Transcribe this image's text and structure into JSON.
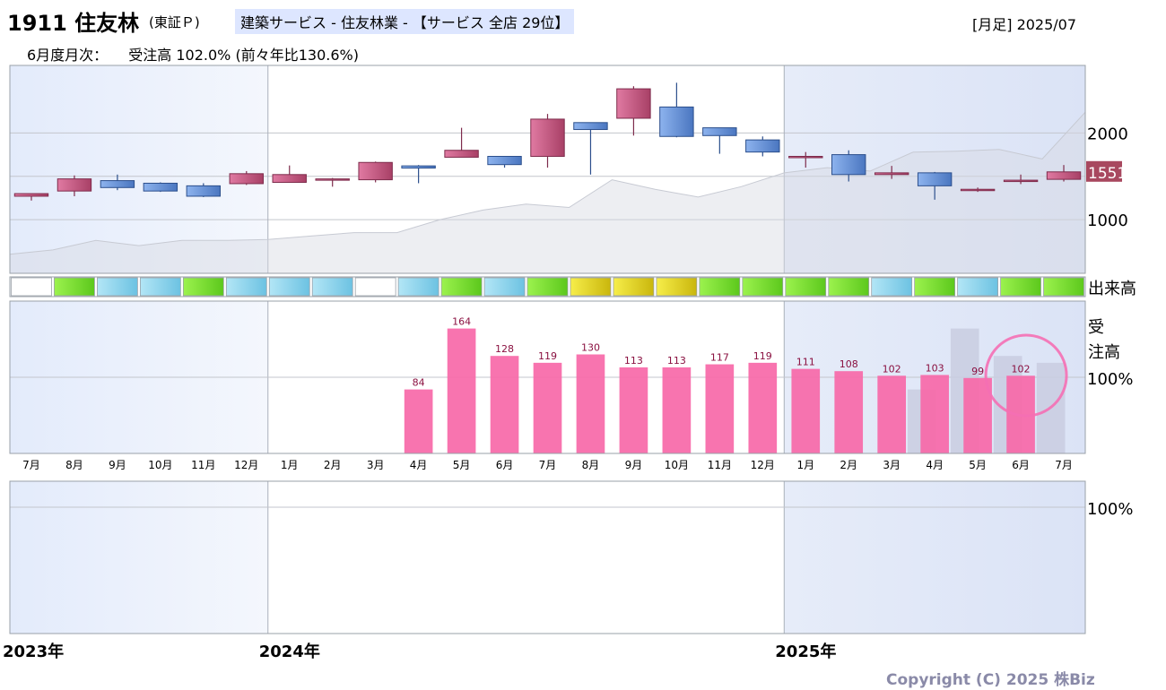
{
  "header": {
    "code_name": "1911 住友林",
    "exchange": "(東証Ｐ)",
    "sector": "建築サービス - 住友林業 - 【サービス 全店 29位】",
    "period": "[月足] 2025/07",
    "monthly_label": "6月度月次：",
    "monthly_value": "受注高 102.0% (前々年比130.6%)"
  },
  "copyright": "Copyright (C) 2025 株Biz",
  "colors": {
    "up": "#c8517a",
    "down": "#5b8bd6",
    "order_bar": "#f768a8",
    "prev_bar": "#c9cce0",
    "highlight_ring": "#f56fb4",
    "shade": "#eaf0fb",
    "volume_light": "#ffffff",
    "volume_green": "#7de632",
    "volume_blue": "#8fd6ee",
    "volume_yellow": "#e8da20"
  },
  "chart_data": [
    {
      "type": "candlestick",
      "title": "",
      "x": [
        "2023/07",
        "2023/08",
        "2023/09",
        "2023/10",
        "2023/11",
        "2023/12",
        "2024/01",
        "2024/02",
        "2024/03",
        "2024/04",
        "2024/05",
        "2024/06",
        "2024/07",
        "2024/08",
        "2024/09",
        "2024/10",
        "2024/11",
        "2024/12",
        "2025/01",
        "2025/02",
        "2025/03",
        "2025/04",
        "2025/05",
        "2025/06",
        "2025/07"
      ],
      "open": [
        1270,
        1330,
        1450,
        1420,
        1390,
        1415,
        1430,
        1460,
        1460,
        1620,
        1720,
        1730,
        1730,
        2120,
        2170,
        2300,
        2060,
        1920,
        1730,
        1750,
        1520,
        1540,
        1350,
        1445,
        1465
      ],
      "close": [
        1300,
        1470,
        1370,
        1330,
        1270,
        1530,
        1520,
        1470,
        1660,
        1595,
        1800,
        1635,
        2160,
        2040,
        2510,
        1960,
        1970,
        1780,
        1730,
        1520,
        1540,
        1390,
        1350,
        1455,
        1551
      ],
      "high": [
        1300,
        1510,
        1520,
        1430,
        1420,
        1560,
        1625,
        1480,
        1670,
        1630,
        2060,
        1730,
        2220,
        2040,
        2540,
        2580,
        2050,
        1960,
        1780,
        1800,
        1620,
        1550,
        1370,
        1520,
        1630
      ],
      "low": [
        1220,
        1270,
        1340,
        1320,
        1260,
        1400,
        1440,
        1380,
        1430,
        1420,
        1780,
        1600,
        1600,
        1520,
        1970,
        1950,
        1760,
        1730,
        1600,
        1440,
        1470,
        1230,
        1320,
        1410,
        1440
      ],
      "overlay_area": {
        "name": "",
        "values": [
          600,
          650,
          760,
          700,
          760,
          760,
          770,
          810,
          850,
          850,
          1000,
          1110,
          1180,
          1140,
          1460,
          1350,
          1260,
          1380,
          1540,
          1600,
          1560,
          1780,
          1790,
          1810,
          1700,
          2240
        ]
      },
      "last_price": 1551,
      "y_ticks": [
        1000,
        2000
      ],
      "ylim": [
        380,
        2780
      ]
    },
    {
      "type": "color_strip",
      "label": "出来高",
      "colors": [
        "light",
        "green",
        "blue",
        "blue",
        "green",
        "blue",
        "blue",
        "blue",
        "light",
        "blue",
        "green",
        "blue",
        "green",
        "yellow",
        "yellow",
        "yellow",
        "green",
        "green",
        "green",
        "green",
        "blue",
        "green",
        "blue",
        "green",
        "green"
      ]
    },
    {
      "type": "bar",
      "label_lines": [
        "受",
        "注高"
      ],
      "y_tick": "100%",
      "categories": [
        "7月",
        "8月",
        "9月",
        "10月",
        "11月",
        "12月",
        "1月",
        "2月",
        "3月",
        "4月",
        "5月",
        "6月",
        "7月",
        "8月",
        "9月",
        "10月",
        "11月",
        "12月",
        "1月",
        "2月",
        "3月",
        "4月",
        "5月",
        "6月",
        "7月"
      ],
      "values": [
        null,
        null,
        null,
        null,
        null,
        null,
        null,
        null,
        null,
        84,
        164,
        128,
        119,
        130,
        113,
        113,
        117,
        119,
        111,
        108,
        102,
        103,
        99,
        102,
        null
      ],
      "prev_values": [
        null,
        null,
        null,
        null,
        null,
        null,
        null,
        null,
        null,
        null,
        null,
        null,
        null,
        null,
        null,
        null,
        null,
        null,
        null,
        null,
        null,
        84,
        164,
        128,
        119
      ],
      "highlight_index": 23,
      "ylim": [
        0,
        200
      ]
    },
    {
      "type": "empty_panel",
      "y_tick": "100%"
    }
  ],
  "years": [
    "2023年",
    "2024年",
    "2025年"
  ]
}
